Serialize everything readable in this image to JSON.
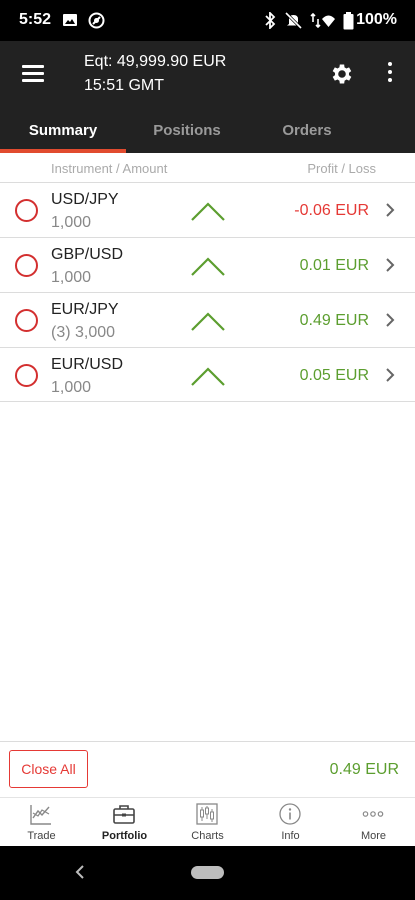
{
  "status_bar": {
    "time": "5:52",
    "battery_text": "100%"
  },
  "header": {
    "equity": "Eqt: 49,999.90 EUR",
    "time": "15:51 GMT"
  },
  "tabs": [
    {
      "label": "Summary",
      "active": true
    },
    {
      "label": "Positions",
      "active": false
    },
    {
      "label": "Orders",
      "active": false
    }
  ],
  "columns": {
    "left": "Instrument / Amount",
    "right": "Profit / Loss"
  },
  "positions": [
    {
      "instrument": "USD/JPY",
      "amount": "1,000",
      "trend": "up",
      "pl": "-0.06 EUR"
    },
    {
      "instrument": "GBP/USD",
      "amount": "1,000",
      "trend": "up",
      "pl": "0.01 EUR"
    },
    {
      "instrument": "EUR/JPY",
      "amount": "(3) 3,000",
      "trend": "up",
      "pl": "0.49 EUR"
    },
    {
      "instrument": "EUR/USD",
      "amount": "1,000",
      "trend": "up",
      "pl": "0.05 EUR"
    }
  ],
  "footer": {
    "close_all": "Close All",
    "total_pl": "0.49 EUR"
  },
  "bottom_nav": [
    {
      "label": "Trade",
      "icon": "trade-chart-icon",
      "active": false
    },
    {
      "label": "Portfolio",
      "icon": "briefcase-icon",
      "active": true
    },
    {
      "label": "Charts",
      "icon": "candlestick-chart-icon",
      "active": false
    },
    {
      "label": "Info",
      "icon": "info-icon",
      "active": false
    },
    {
      "label": "More",
      "icon": "more-dots-icon",
      "active": false
    }
  ],
  "colors": {
    "accent": "#e14b2f",
    "loss": "#e53935",
    "profit": "#5c9e2f",
    "header_bg": "#222222"
  }
}
